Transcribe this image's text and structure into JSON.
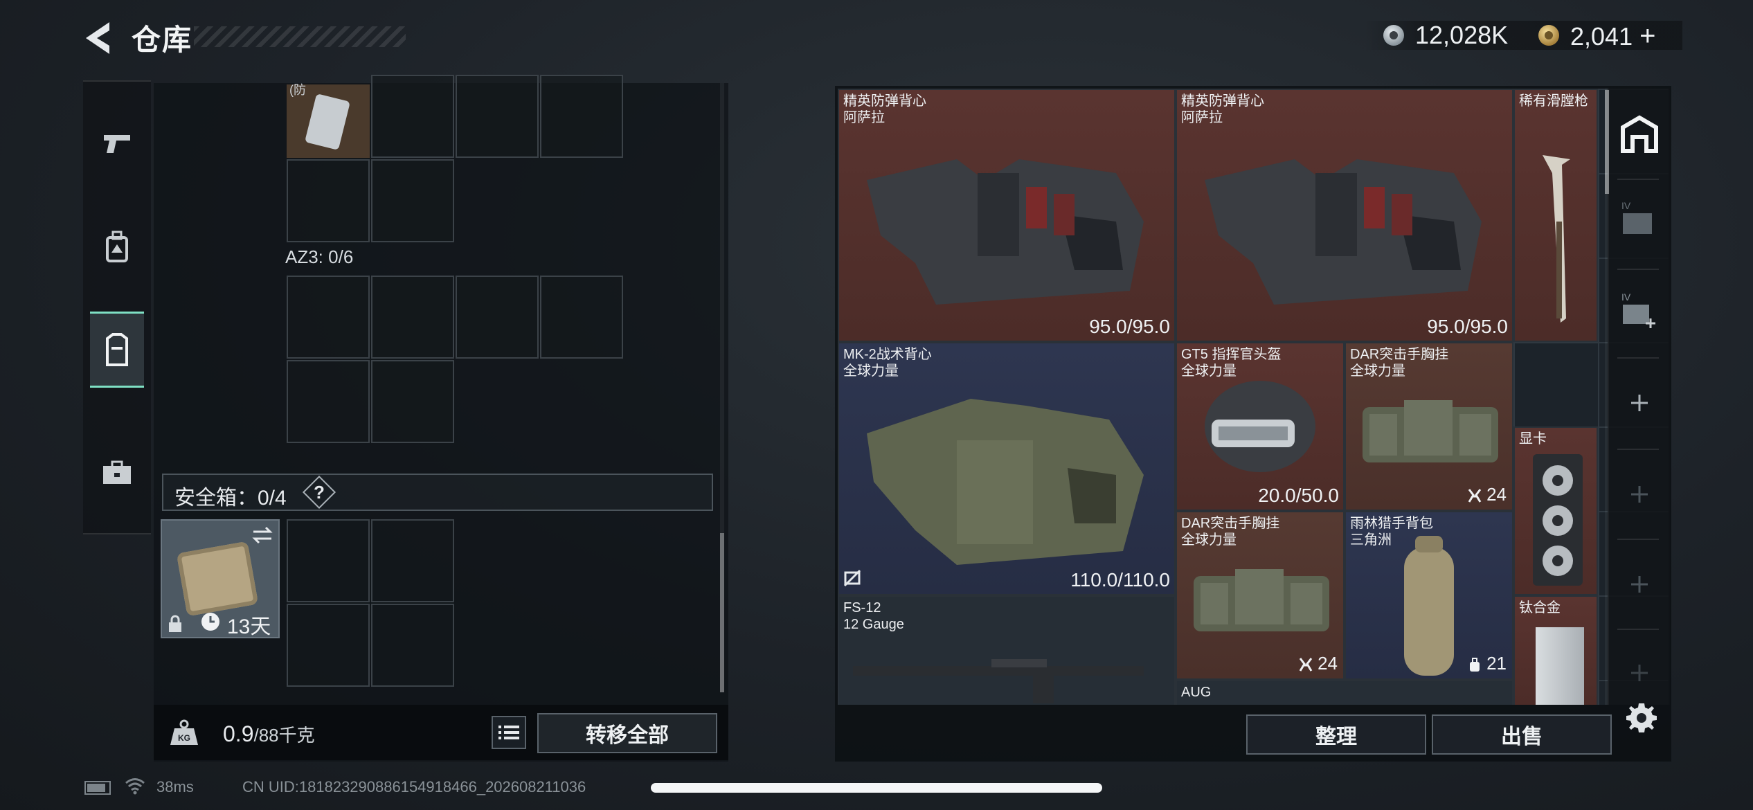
{
  "header": {
    "title": "仓库",
    "currency": [
      {
        "icon": "silver-coin-icon",
        "value": "12,028K"
      },
      {
        "icon": "gold-coin-icon",
        "value": "2,041"
      }
    ],
    "add_symbol": "+"
  },
  "left_rail": {
    "items": [
      {
        "icon": "pistol-icon",
        "active": false
      },
      {
        "icon": "backpack-icon",
        "active": false
      },
      {
        "icon": "vest-icon",
        "active": true
      },
      {
        "icon": "briefcase-icon",
        "active": false
      }
    ]
  },
  "left_panel": {
    "top_item_label": "(防",
    "container_label": "AZ3: 0/6",
    "safe_box_label": "安全箱：0/4",
    "safe_box_help": "?",
    "safe_box_days": "13天",
    "weight_value": "0.9",
    "weight_max": "/88千克",
    "transfer_all": "转移全部"
  },
  "inventory": {
    "items": [
      {
        "name": "精英防弹背心",
        "sub": "阿萨拉",
        "value": "95.0/95.0",
        "rarity": "red"
      },
      {
        "name": "精英防弹背心",
        "sub": "阿萨拉",
        "value": "95.0/95.0",
        "rarity": "red"
      },
      {
        "name": "稀有滑膛枪",
        "sub": "",
        "value": "",
        "rarity": "red"
      },
      {
        "name": "MK-2战术背心",
        "sub": "全球力量",
        "value": "110.0/110.0",
        "rarity": "blue"
      },
      {
        "name": "GT5 指挥官头盔",
        "sub": "全球力量",
        "value": "20.0/50.0",
        "rarity": "red"
      },
      {
        "name": "DAR突击手胸挂",
        "sub": "全球力量",
        "value": "24",
        "rarity": "rust"
      },
      {
        "name": "显卡",
        "sub": "",
        "value": "",
        "rarity": "red"
      },
      {
        "name": "DAR突击手胸挂",
        "sub": "全球力量",
        "value": "24",
        "rarity": "rust"
      },
      {
        "name": "雨林猎手背包",
        "sub": "三角洲",
        "value": "21",
        "rarity": "blue"
      },
      {
        "name": "钛合金",
        "sub": "",
        "value": "",
        "rarity": "red"
      },
      {
        "name": "FS-12",
        "sub": "12 Gauge",
        "value": "",
        "rarity": "gray"
      },
      {
        "name": "AUG",
        "sub": "",
        "value": "",
        "rarity": "gray"
      }
    ],
    "sort_label": "整理",
    "sell_label": "出售"
  },
  "status_bar": {
    "ping": "38ms",
    "uid": "CN UID:18182329088615491846​6_202608211036"
  }
}
